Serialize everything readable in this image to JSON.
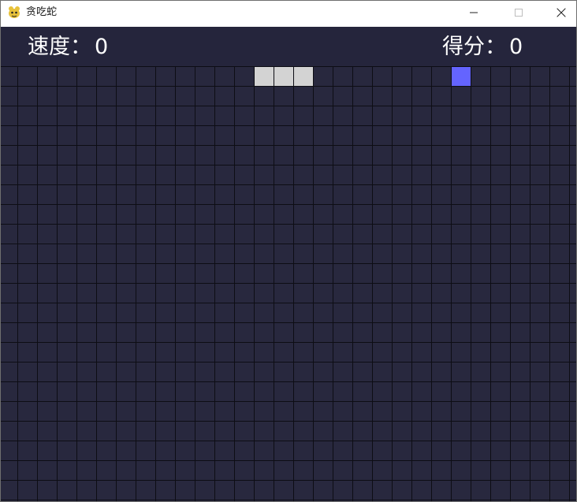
{
  "window": {
    "title": "贪吃蛇",
    "icon": "pygame-snake-icon"
  },
  "hud": {
    "speed_label": "速度：",
    "speed_value": "0",
    "score_label": "得分：",
    "score_value": "0"
  },
  "board": {
    "columns": 30,
    "rows": 22
  },
  "colors": {
    "background": "#25253c",
    "grid_line": "#0d0d14",
    "snake": "#d3d3d3",
    "food": "#6464ff",
    "text": "#ffffff"
  },
  "snake": [
    {
      "col": 15,
      "row": 0
    },
    {
      "col": 14,
      "row": 0
    },
    {
      "col": 13,
      "row": 0
    }
  ],
  "food": {
    "col": 23,
    "row": 0
  }
}
